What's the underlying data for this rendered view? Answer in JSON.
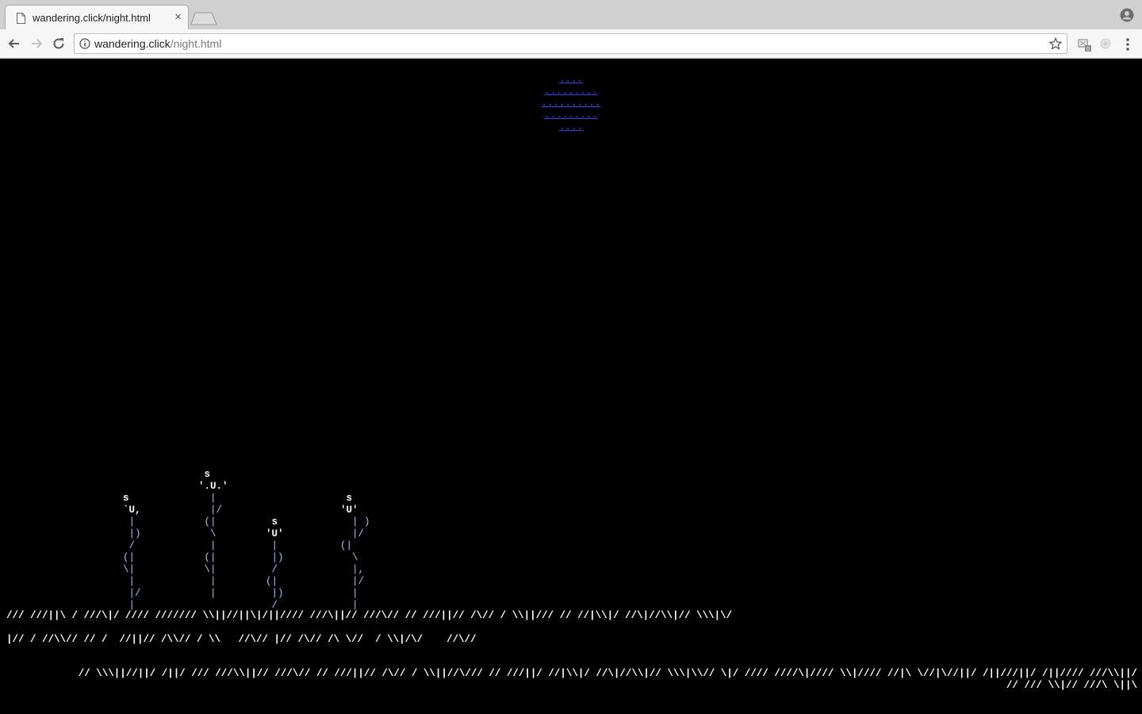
{
  "browser": {
    "tab_title": "wandering.click/night.html",
    "tab_close_glyph": "×",
    "url_host": "wandering.click",
    "url_path": "/night.html",
    "icons": [
      "document-icon",
      "new-tab-icon",
      "profile-icon",
      "back-icon",
      "forward-icon",
      "reload-icon",
      "info-icon",
      "star-icon",
      "extension-icon",
      "extension-icon-2",
      "menu-icon"
    ]
  },
  "scene": {
    "moon": "....\n.........\n..........\n.........\n....",
    "plants": [
      {
        "flower": "s\n`U,",
        "stem": " |\n |)\n /\n(|\n\\|\n |\n |/\n |"
      },
      {
        "flower": " s\n'.U.'",
        "stem": "  |\n  |/\n (|\n  \\\n  |\n (|\n \\|\n  |\n  |"
      },
      {
        "flower": " s\n'U'",
        "stem": " |\n |)\n /\n(|\n |)\n /"
      },
      {
        "flower": " s\n'U'",
        "stem": "  | )\n  |/\n(|\n  \\\n  |,\n  |/\n  |\n  |"
      }
    ],
    "grass_row_1": "/// ///||\\ / ///\\|/ //// /////// \\\\||//||\\|/||//// ///\\||// ///\\// // ///||// /\\// / \\\\||/// // //|\\\\|/ //\\|//\\\\|// \\\\\\|\\/",
    "grass_row_2": "|// / //\\\\// // /  //||// /\\\\// / \\\\   //\\// |// /\\// /\\ \\//  / \\\\|/\\/    //\\//",
    "grass_row_3": "// \\\\\\||//||/ /||/ /// ///\\\\||// ///\\// // ///||// /\\// / \\\\||//\\/// // ///||/ //|\\\\|/ //\\|//\\\\|// \\\\\\|\\\\// \\|/ //// ////\\|//// \\\\|//// //|\\ \\//|\\//||/ /||///||/ /||//// ///\\\\||/",
    "grass_row_4": "// /// \\\\|// ///\\ \\||\\"
  }
}
